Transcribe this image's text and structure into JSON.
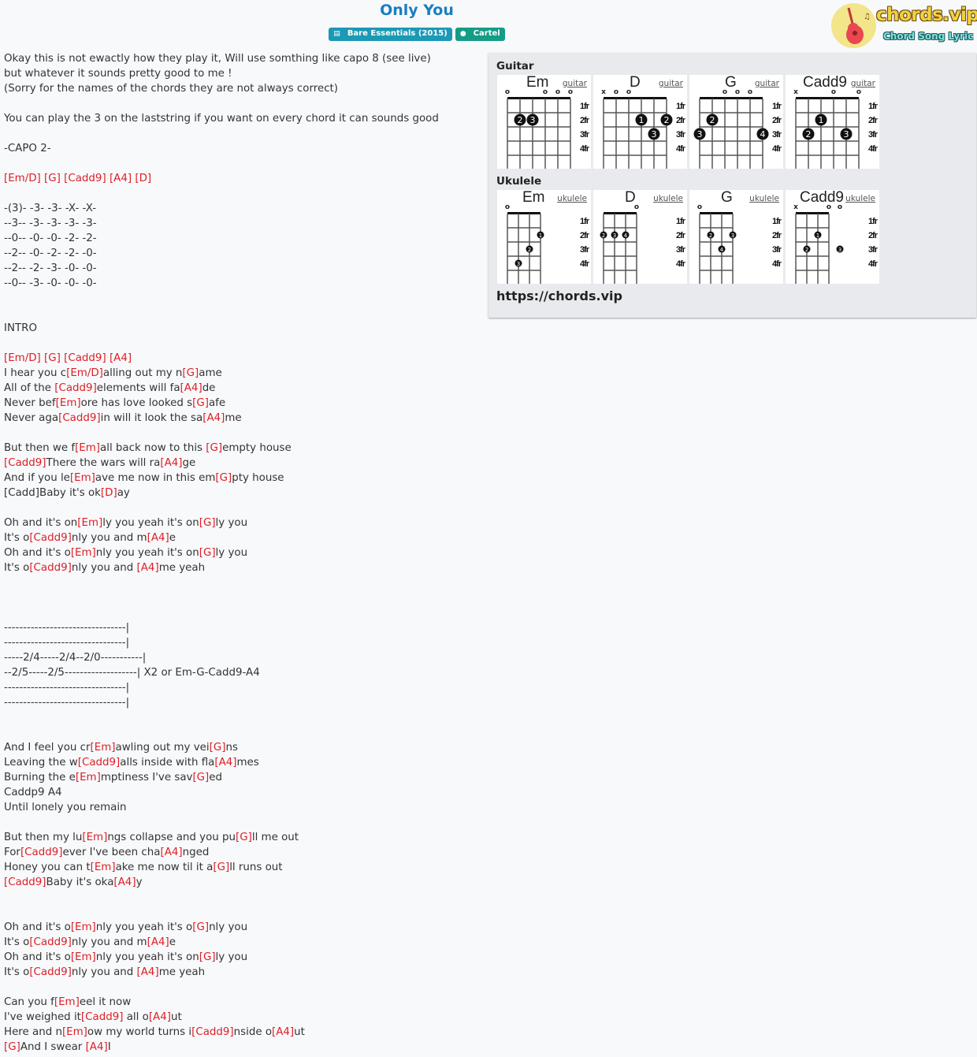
{
  "song": {
    "title": "Only You",
    "album_badge": "Bare Essentials (2015)",
    "artist_badge": "Cartel",
    "album_icon": "book-icon",
    "artist_icon": "user-icon"
  },
  "logo": {
    "brand": "chords.vip",
    "tagline": "Chord Song Lyric",
    "icon": "guitar-icon"
  },
  "colors": {
    "title": "#1a7fc1",
    "chord": "#dd1f26",
    "album_badge": "#1b99b5",
    "artist_badge": "#159c85"
  },
  "lyrics": [
    [
      {
        "t": "Okay this is not ewactly how they play it, Will use somthing like capo 8 (see live)"
      }
    ],
    [
      {
        "t": "but whatever it sounds pretty good to me !"
      }
    ],
    [
      {
        "t": "(Sorry for the names of the chords they are not always correct)"
      }
    ],
    [],
    [
      {
        "t": "You can play the 3 on the laststring if you want on every chord it can sounds good"
      }
    ],
    [],
    [
      {
        "t": "-CAPO 2-"
      }
    ],
    [],
    [
      {
        "c": "[Em/D]"
      },
      {
        "t": " "
      },
      {
        "c": "[G]"
      },
      {
        "t": " "
      },
      {
        "c": "[Cadd9]"
      },
      {
        "t": " "
      },
      {
        "c": "[A4]"
      },
      {
        "t": " "
      },
      {
        "c": "[D]"
      }
    ],
    [],
    [
      {
        "t": "-(3)- -3- -3- -X- -X-"
      }
    ],
    [
      {
        "t": "--3-- -3- -3- -3- -3-"
      }
    ],
    [
      {
        "t": "--0-- -0- -0- -2- -2-"
      }
    ],
    [
      {
        "t": "--2-- -0- -2- -2- -0-"
      }
    ],
    [
      {
        "t": "--2-- -2- -3- -0- -0-"
      }
    ],
    [
      {
        "t": "--0-- -3- -0- -0- -0-"
      }
    ],
    [],
    [],
    [
      {
        "t": "INTRO"
      }
    ],
    [],
    [
      {
        "c": "[Em/D]"
      },
      {
        "t": " "
      },
      {
        "c": "[G]"
      },
      {
        "t": " "
      },
      {
        "c": "[Cadd9]"
      },
      {
        "t": " "
      },
      {
        "c": "[A4]"
      }
    ],
    [
      {
        "t": "I hear you c"
      },
      {
        "c": "[Em/D]"
      },
      {
        "t": "alling out my n"
      },
      {
        "c": "[G]"
      },
      {
        "t": "ame"
      }
    ],
    [
      {
        "t": "All of the "
      },
      {
        "c": "[Cadd9]"
      },
      {
        "t": "elements will fa"
      },
      {
        "c": "[A4]"
      },
      {
        "t": "de"
      }
    ],
    [
      {
        "t": "Never bef"
      },
      {
        "c": "[Em]"
      },
      {
        "t": "ore has love looked s"
      },
      {
        "c": "[G]"
      },
      {
        "t": "afe"
      }
    ],
    [
      {
        "t": "Never aga"
      },
      {
        "c": "[Cadd9]"
      },
      {
        "t": "in will it look the sa"
      },
      {
        "c": "[A4]"
      },
      {
        "t": "me"
      }
    ],
    [],
    [
      {
        "t": "But then we f"
      },
      {
        "c": "[Em]"
      },
      {
        "t": "all back now to this "
      },
      {
        "c": "[G]"
      },
      {
        "t": "empty house"
      }
    ],
    [
      {
        "c": "[Cadd9]"
      },
      {
        "t": "There the wars will ra"
      },
      {
        "c": "[A4]"
      },
      {
        "t": "ge"
      }
    ],
    [
      {
        "t": "And if you le"
      },
      {
        "c": "[Em]"
      },
      {
        "t": "ave me now in this em"
      },
      {
        "c": "[G]"
      },
      {
        "t": "pty house"
      }
    ],
    [
      {
        "t": "[Cadd]Baby it's ok"
      },
      {
        "c": "[D]"
      },
      {
        "t": "ay"
      }
    ],
    [],
    [
      {
        "t": "Oh and it's on"
      },
      {
        "c": "[Em]"
      },
      {
        "t": "ly you yeah it's on"
      },
      {
        "c": "[G]"
      },
      {
        "t": "ly you"
      }
    ],
    [
      {
        "t": "It's o"
      },
      {
        "c": "[Cadd9]"
      },
      {
        "t": "nly you and m"
      },
      {
        "c": "[A4]"
      },
      {
        "t": "e"
      }
    ],
    [
      {
        "t": "Oh and it's o"
      },
      {
        "c": "[Em]"
      },
      {
        "t": "nly you yeah it's on"
      },
      {
        "c": "[G]"
      },
      {
        "t": "ly you"
      }
    ],
    [
      {
        "t": "It's o"
      },
      {
        "c": "[Cadd9]"
      },
      {
        "t": "nly you and "
      },
      {
        "c": "[A4]"
      },
      {
        "t": "me yeah"
      }
    ],
    [],
    [],
    [],
    [
      {
        "t": "--------------------------------|"
      }
    ],
    [
      {
        "t": "--------------------------------|"
      }
    ],
    [
      {
        "t": "-----2/4-----2/4--2/0-----------|"
      }
    ],
    [
      {
        "t": "--2/5-----2/5-------------------| X2 or Em-G-Cadd9-A4"
      }
    ],
    [
      {
        "t": "--------------------------------|"
      }
    ],
    [
      {
        "t": "--------------------------------|"
      }
    ],
    [],
    [],
    [
      {
        "t": "And I feel you cr"
      },
      {
        "c": "[Em]"
      },
      {
        "t": "awling out my vei"
      },
      {
        "c": "[G]"
      },
      {
        "t": "ns"
      }
    ],
    [
      {
        "t": "Leaving the w"
      },
      {
        "c": "[Cadd9]"
      },
      {
        "t": "alls inside with fla"
      },
      {
        "c": "[A4]"
      },
      {
        "t": "mes"
      }
    ],
    [
      {
        "t": "Burning the e"
      },
      {
        "c": "[Em]"
      },
      {
        "t": "mptiness I've sav"
      },
      {
        "c": "[G]"
      },
      {
        "t": "ed"
      }
    ],
    [
      {
        "t": "Caddp9 A4"
      }
    ],
    [
      {
        "t": "Until lonely you remain"
      }
    ],
    [],
    [
      {
        "t": "But then my lu"
      },
      {
        "c": "[Em]"
      },
      {
        "t": "ngs collapse and you pu"
      },
      {
        "c": "[G]"
      },
      {
        "t": "ll me out"
      }
    ],
    [
      {
        "t": "For"
      },
      {
        "c": "[Cadd9]"
      },
      {
        "t": "ever I've been cha"
      },
      {
        "c": "[A4]"
      },
      {
        "t": "nged"
      }
    ],
    [
      {
        "t": "Honey you can t"
      },
      {
        "c": "[Em]"
      },
      {
        "t": "ake me now til it a"
      },
      {
        "c": "[G]"
      },
      {
        "t": "ll runs out"
      }
    ],
    [
      {
        "c": "[Cadd9]"
      },
      {
        "t": "Baby it's oka"
      },
      {
        "c": "[A4]"
      },
      {
        "t": "y"
      }
    ],
    [],
    [],
    [
      {
        "t": "Oh and it's o"
      },
      {
        "c": "[Em]"
      },
      {
        "t": "nly you yeah it's o"
      },
      {
        "c": "[G]"
      },
      {
        "t": "nly you"
      }
    ],
    [
      {
        "t": "It's o"
      },
      {
        "c": "[Cadd9]"
      },
      {
        "t": "nly you and m"
      },
      {
        "c": "[A4]"
      },
      {
        "t": "e"
      }
    ],
    [
      {
        "t": "Oh and it's o"
      },
      {
        "c": "[Em]"
      },
      {
        "t": "nly you yeah it's on"
      },
      {
        "c": "[G]"
      },
      {
        "t": "ly you"
      }
    ],
    [
      {
        "t": "It's o"
      },
      {
        "c": "[Cadd9]"
      },
      {
        "t": "nly you and "
      },
      {
        "c": "[A4]"
      },
      {
        "t": "me yeah"
      }
    ],
    [],
    [
      {
        "t": "Can you f"
      },
      {
        "c": "[Em]"
      },
      {
        "t": "eel it now"
      }
    ],
    [
      {
        "t": "I've weighed it"
      },
      {
        "c": "[Cadd9]"
      },
      {
        "t": " all o"
      },
      {
        "c": "[A4]"
      },
      {
        "t": "ut"
      }
    ],
    [
      {
        "t": "Here and n"
      },
      {
        "c": "[Em]"
      },
      {
        "t": "ow my world turns i"
      },
      {
        "c": "[Cadd9]"
      },
      {
        "t": "nside o"
      },
      {
        "c": "[A4]"
      },
      {
        "t": "ut"
      }
    ],
    [
      {
        "c": "[G]"
      },
      {
        "t": "And I swear "
      },
      {
        "c": "[A4]"
      },
      {
        "t": "I"
      }
    ]
  ],
  "diagrams": {
    "guitar_heading": "Guitar",
    "ukulele_heading": "Ukulele",
    "fret_labels": [
      "1fr",
      "2fr",
      "3fr",
      "4fr"
    ],
    "guitar": [
      {
        "name": "Em",
        "link": "guitar",
        "markers": [
          "o",
          "",
          "",
          "o",
          "o",
          "o"
        ],
        "dots": [
          {
            "s": 2,
            "f": 2,
            "n": "2"
          },
          {
            "s": 3,
            "f": 2,
            "n": "3"
          }
        ]
      },
      {
        "name": "D",
        "link": "guitar",
        "markers": [
          "x",
          "o",
          "o",
          "",
          "",
          ""
        ],
        "dots": [
          {
            "s": 4,
            "f": 2,
            "n": "1"
          },
          {
            "s": 6,
            "f": 2,
            "n": "2"
          },
          {
            "s": 5,
            "f": 3,
            "n": "3"
          }
        ]
      },
      {
        "name": "G",
        "link": "guitar",
        "markers": [
          "",
          "",
          "o",
          "o",
          "o",
          ""
        ],
        "dots": [
          {
            "s": 2,
            "f": 2,
            "n": "2"
          },
          {
            "s": 1,
            "f": 3,
            "n": "3"
          },
          {
            "s": 6,
            "f": 3,
            "n": "4"
          }
        ]
      },
      {
        "name": "Cadd9",
        "link": "guitar",
        "markers": [
          "x",
          "",
          "",
          "o",
          "",
          "o"
        ],
        "dots": [
          {
            "s": 3,
            "f": 2,
            "n": "1"
          },
          {
            "s": 2,
            "f": 3,
            "n": "2"
          },
          {
            "s": 5,
            "f": 3,
            "n": "3"
          }
        ]
      }
    ],
    "ukulele": [
      {
        "name": "Em",
        "link": "ukulele",
        "markers": [
          "o",
          "",
          "",
          ""
        ],
        "dots": [
          {
            "s": 4,
            "f": 2,
            "n": "1"
          },
          {
            "s": 3,
            "f": 3,
            "n": "2"
          },
          {
            "s": 2,
            "f": 4,
            "n": "3"
          }
        ]
      },
      {
        "name": "D",
        "link": "ukulele",
        "markers": [
          "",
          "",
          "",
          "o"
        ],
        "dots": [
          {
            "s": 1,
            "f": 2,
            "n": "2"
          },
          {
            "s": 2,
            "f": 2,
            "n": "3"
          },
          {
            "s": 3,
            "f": 2,
            "n": "4"
          }
        ]
      },
      {
        "name": "G",
        "link": "ukulele",
        "markers": [
          "o",
          "",
          "",
          ""
        ],
        "dots": [
          {
            "s": 2,
            "f": 2,
            "n": "2"
          },
          {
            "s": 4,
            "f": 2,
            "n": "3"
          },
          {
            "s": 3,
            "f": 3,
            "n": "4"
          }
        ]
      },
      {
        "name": "Cadd9",
        "link": "ukulele",
        "markers": [
          "x",
          "",
          "",
          "o",
          "o"
        ],
        "dots": [
          {
            "s": 3,
            "f": 2,
            "n": "1"
          },
          {
            "s": 2,
            "f": 3,
            "n": "2"
          },
          {
            "s": 5,
            "f": 3,
            "n": "3"
          }
        ]
      }
    ],
    "site_url": "https://chords.vip"
  }
}
